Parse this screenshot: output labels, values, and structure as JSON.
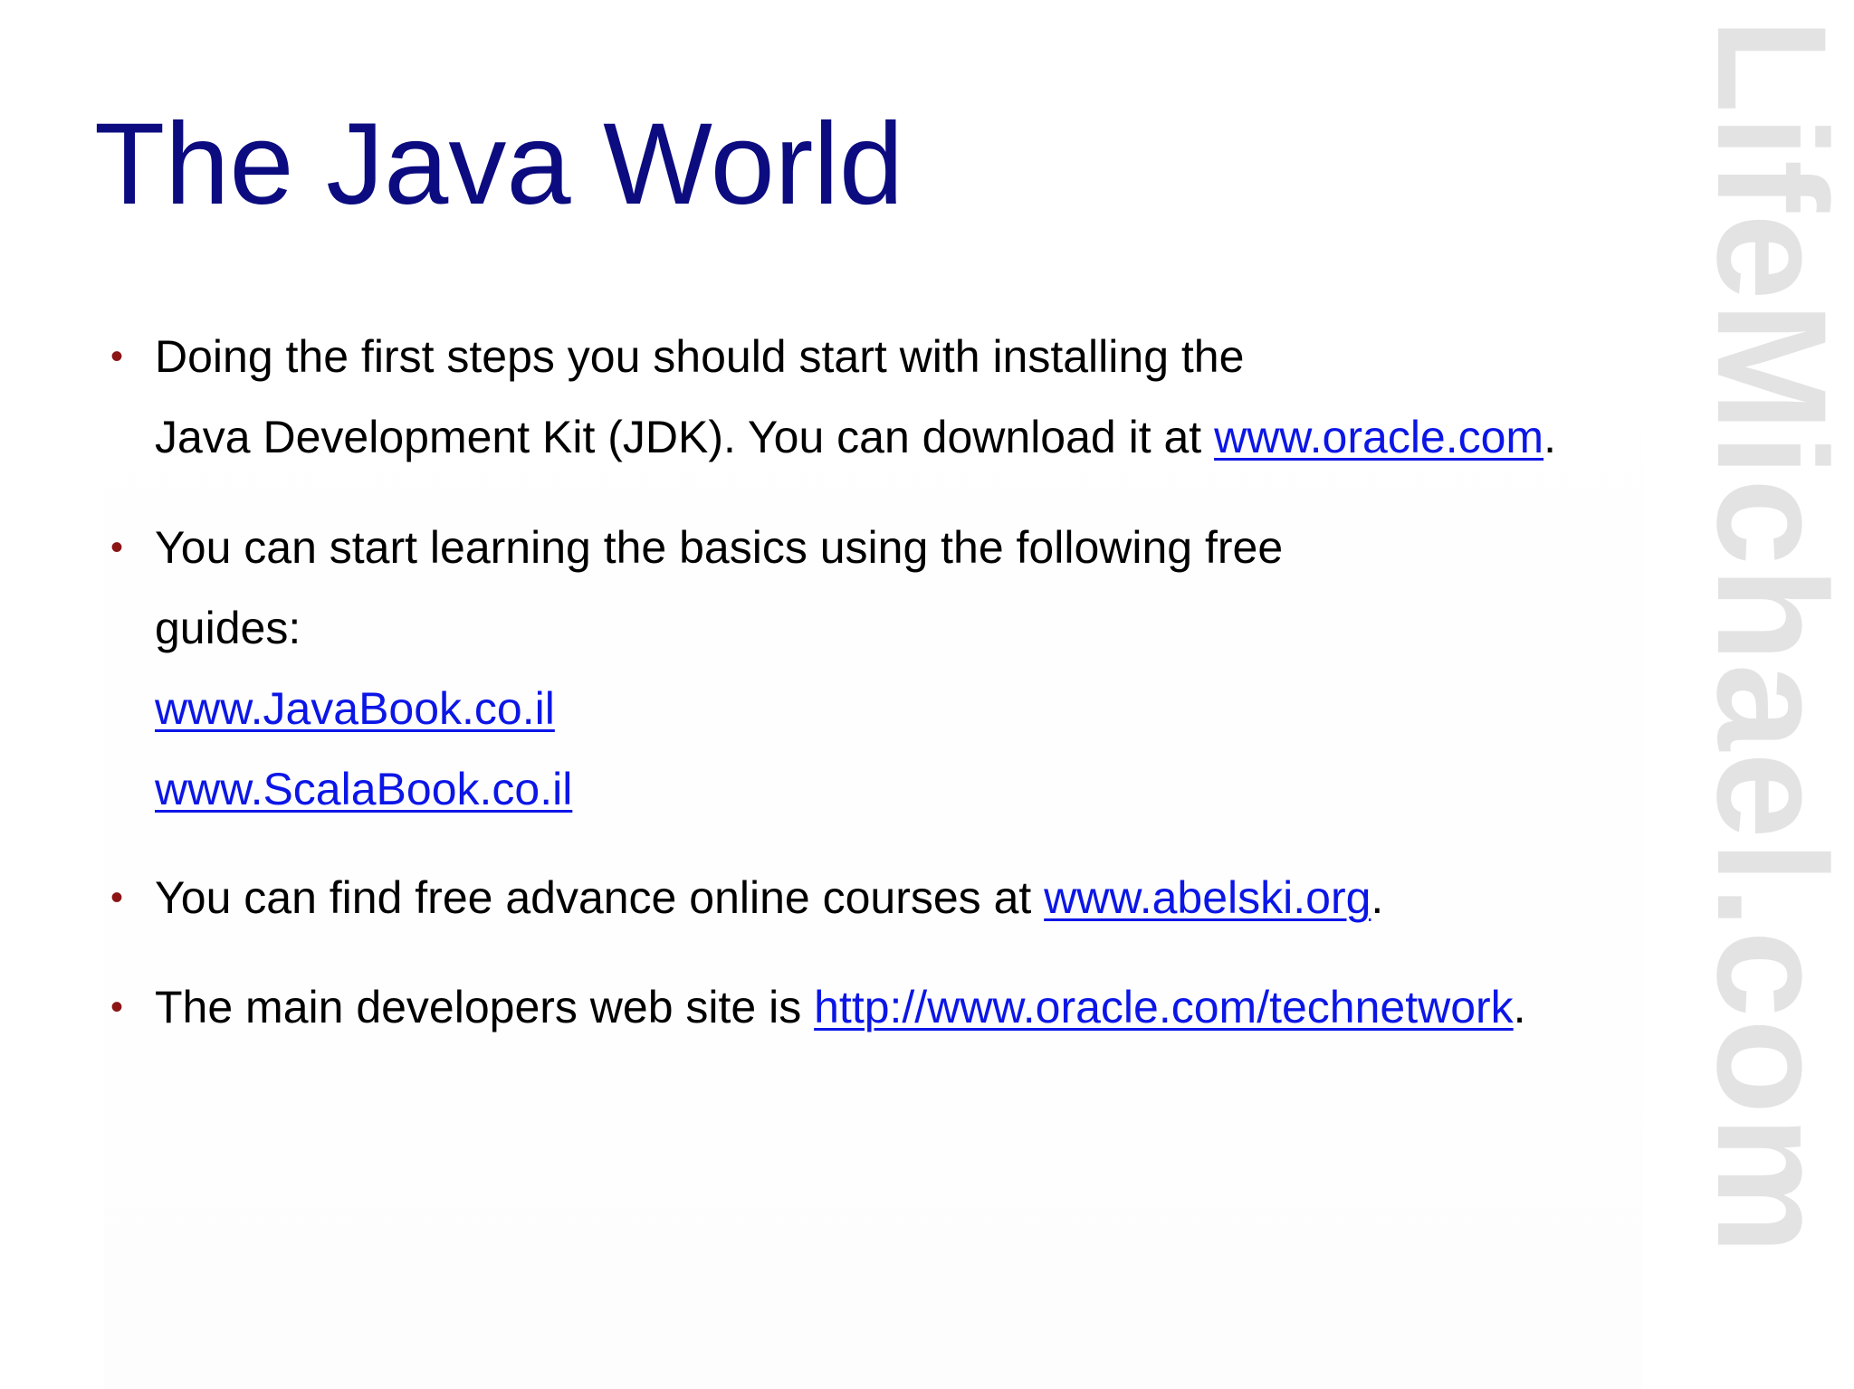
{
  "slide": {
    "title": "The Java World",
    "watermark": "LifeMichael.com",
    "bullet_symbol": "•",
    "bullets": [
      {
        "line1": "Doing the first steps you should start with installing the",
        "line2_prefix": "Java Development Kit (JDK). You can download it at ",
        "line2_link": "www.oracle.com",
        "line2_suffix": "."
      },
      {
        "line1": "You can start learning the basics using the following free",
        "line2": "guides:",
        "link1": "www.JavaBook.co.il",
        "link2": "www.ScalaBook.co.il"
      },
      {
        "prefix": "You can find free advance online courses at ",
        "link": "www.abelski.org",
        "suffix": "."
      },
      {
        "prefix": "The main developers web site is ",
        "link": "http://www.oracle.com/technetwork",
        "suffix": "."
      }
    ]
  },
  "colors": {
    "title": "#0c0c80",
    "bullet": "#8c1414",
    "link": "#0b16e6",
    "body_text": "#000000",
    "watermark": "#e3e3e3"
  }
}
